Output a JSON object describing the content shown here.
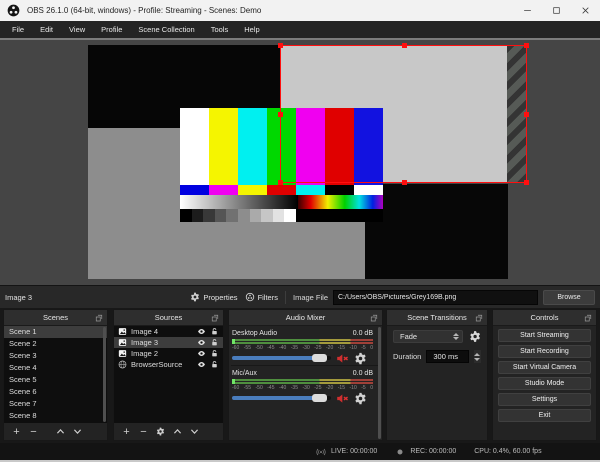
{
  "window": {
    "title": "OBS 26.1.0 (64-bit, windows) - Profile: Streaming - Scenes: Demo"
  },
  "menu": {
    "items": [
      "File",
      "Edit",
      "View",
      "Profile",
      "Scene Collection",
      "Tools",
      "Help"
    ]
  },
  "toolbar": {
    "source_label": "Image 3",
    "properties_label": "Properties",
    "filters_label": "Filters",
    "image_file_label": "Image File",
    "image_file_value": "C:/Users/OBS/Pictures/Grey169B.png",
    "browse_label": "Browse"
  },
  "scenes": {
    "title": "Scenes",
    "items": [
      "Scene 1",
      "Scene 2",
      "Scene 3",
      "Scene 4",
      "Scene 5",
      "Scene 6",
      "Scene 7",
      "Scene 8"
    ],
    "selected": "Scene 1"
  },
  "sources": {
    "title": "Sources",
    "items": [
      {
        "name": "Image 4",
        "type": "image"
      },
      {
        "name": "Image 3",
        "type": "image"
      },
      {
        "name": "Image 2",
        "type": "image"
      },
      {
        "name": "BrowserSource",
        "type": "browser"
      }
    ],
    "selected": "Image 3"
  },
  "mixer": {
    "title": "Audio Mixer",
    "channels": [
      {
        "name": "Desktop Audio",
        "volume": "0.0 dB",
        "muted": true
      },
      {
        "name": "Mic/Aux",
        "volume": "0.0 dB",
        "muted": true
      }
    ],
    "scale_ticks": [
      "-60",
      "-55",
      "-50",
      "-45",
      "-40",
      "-35",
      "-30",
      "-25",
      "-20",
      "-15",
      "-10",
      "-5",
      "0"
    ]
  },
  "transitions": {
    "title": "Scene Transitions",
    "selected_transition": "Fade",
    "duration_label": "Duration",
    "duration_value": "300 ms"
  },
  "controls": {
    "title": "Controls",
    "buttons": [
      "Start Streaming",
      "Start Recording",
      "Start Virtual Camera",
      "Studio Mode",
      "Settings",
      "Exit"
    ]
  },
  "statusbar": {
    "live": "LIVE: 00:00:00",
    "rec": "REC: 00:00:00",
    "cpu": "CPU: 0.4%, 60.00 fps"
  },
  "icons": {
    "properties": "gear",
    "filters": "filter-circles",
    "image_source": "photo",
    "browser_source": "globe",
    "visibility": "eye",
    "lock": "padlock",
    "mute": "speaker-muted-red",
    "live": "broadcast",
    "rec": "dot"
  },
  "colors": {
    "selection_red": "#ff0f0f",
    "slider_blue": "#4a7dbd",
    "meter_green": "#4f8f3f",
    "meter_yellow": "#a39a3d",
    "meter_red": "#9f4038",
    "titlebar_bg": "#f2f2f2",
    "menubar_bg": "#242424",
    "preview_void": "#454545"
  }
}
